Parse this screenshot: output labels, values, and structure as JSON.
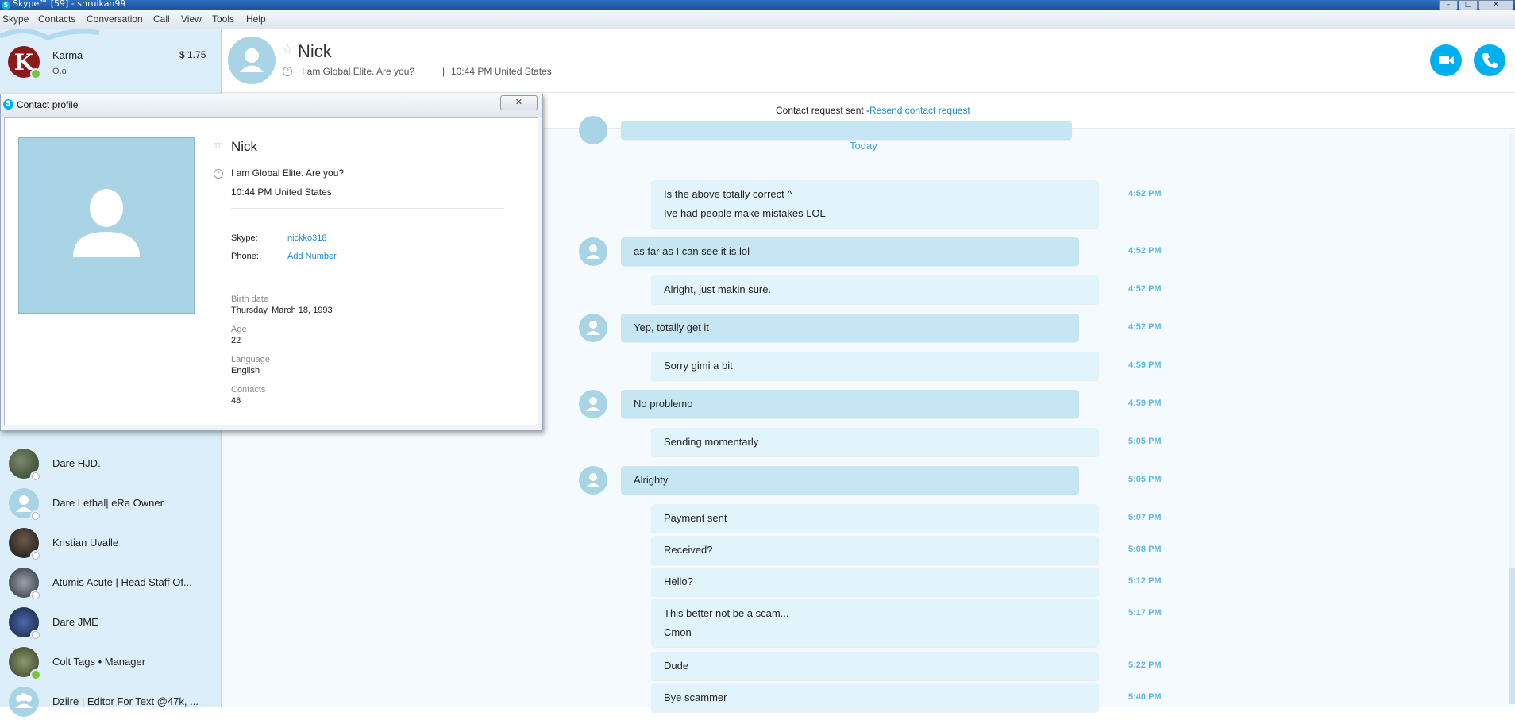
{
  "window": {
    "title": "Skype™ [59] - shruikan99",
    "controls": [
      "–",
      "□",
      "✕"
    ]
  },
  "menubar": [
    "Skype",
    "Contacts",
    "Conversation",
    "Call",
    "View",
    "Tools",
    "Help"
  ],
  "profile": {
    "initial": "K",
    "name": "Karma",
    "mood": "O.o",
    "credit": "$ 1.75"
  },
  "contacts": [
    {
      "name": "Dare HJD.",
      "status": "unknown"
    },
    {
      "name": "Dare Lethal| eRa Owner",
      "status": "unknown"
    },
    {
      "name": "Kristian Uvalle",
      "status": "unknown"
    },
    {
      "name": "Atumis Acute | Head Staff Of...",
      "status": "unknown"
    },
    {
      "name": "Dare JME",
      "status": "unknown"
    },
    {
      "name": "Colt Tags • Manager",
      "status": "online"
    },
    {
      "name": "Dziire | Editor For Text @47k, ...",
      "status": "group"
    }
  ],
  "conversation": {
    "contact_name": "Nick",
    "mood": "I am Global Elite. Are you?",
    "local_info": "10:44 PM United States",
    "separator": "|",
    "request_text": "Contact request sent - ",
    "request_link": "Resend contact request",
    "day_label": "Today",
    "messages": [
      {
        "from": "me",
        "lines": [
          "Is the above totally correct ^",
          "Ive had people make mistakes LOL"
        ],
        "time": "4:52 PM"
      },
      {
        "from": "nick",
        "lines": [
          "as far as I can see it is lol"
        ],
        "time": "4:52 PM"
      },
      {
        "from": "me",
        "lines": [
          "Alright, just makin sure."
        ],
        "time": "4:52 PM"
      },
      {
        "from": "nick",
        "lines": [
          "Yep, totally get it"
        ],
        "time": "4:52 PM"
      },
      {
        "from": "me",
        "lines": [
          "Sorry gimi a bit"
        ],
        "time": "4:59 PM"
      },
      {
        "from": "nick",
        "lines": [
          "No problemo"
        ],
        "time": "4:59 PM"
      },
      {
        "from": "me",
        "lines": [
          "Sending momentarly"
        ],
        "time": "5:05 PM"
      },
      {
        "from": "nick",
        "lines": [
          "Alrighty"
        ],
        "time": "5:05 PM"
      },
      {
        "from": "me",
        "lines": [
          "Payment sent"
        ],
        "time": "5:07 PM"
      },
      {
        "from": "me",
        "lines": [
          "Received?"
        ],
        "time": "5:08 PM"
      },
      {
        "from": "me",
        "lines": [
          "Hello?"
        ],
        "time": "5:12 PM"
      },
      {
        "from": "me",
        "lines": [
          "This better not be a scam...",
          "Cmon"
        ],
        "time": "5:17 PM"
      },
      {
        "from": "me",
        "lines": [
          "Dude"
        ],
        "time": "5:22 PM"
      },
      {
        "from": "me",
        "lines": [
          "Bye scammer"
        ],
        "time": "5:40 PM"
      }
    ]
  },
  "dialog": {
    "title": "Contact profile",
    "name": "Nick",
    "mood": "I am Global Elite. Are you?",
    "local_info": "10:44 PM United States",
    "skype_label": "Skype:",
    "skype_value": "nickko318",
    "phone_label": "Phone:",
    "phone_value": "Add Number",
    "birth_label": "Birth date",
    "birth_value": "Thursday, March 18, 1993",
    "age_label": "Age",
    "age_value": "22",
    "language_label": "Language",
    "language_value": "English",
    "contacts_label": "Contacts",
    "contacts_value": "48"
  },
  "colors": {
    "accent": "#00aff0",
    "bubble_theirs": "#c7e6f4",
    "bubble_mine": "#e2f4fb",
    "time": "#59b8e6"
  }
}
